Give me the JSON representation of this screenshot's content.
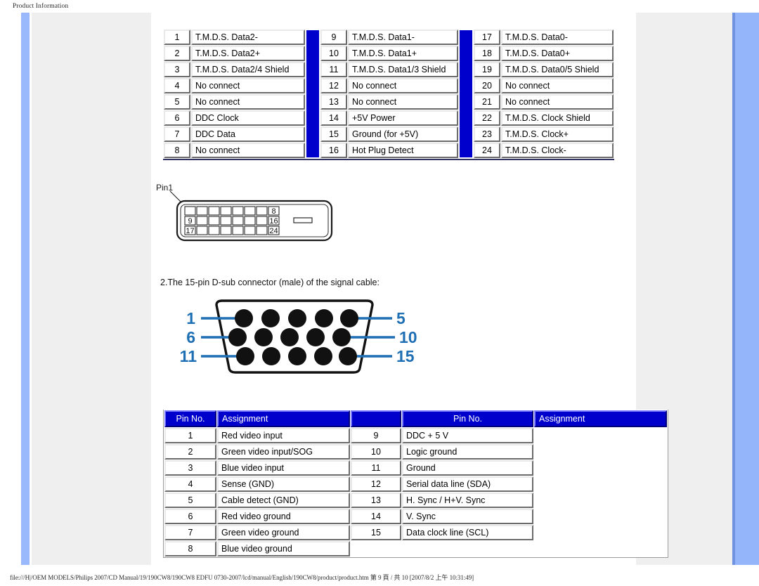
{
  "print_header": "Product Information",
  "print_footer": "file:///H|/OEM MODELS/Philips 2007/CD Manual/19/190CW8/190CW8 EDFU 0730-2007/lcd/manual/English/190CW8/product/product.htm 第 9 頁 / 共 10 [2007/8/2 上午 10:31:49]",
  "colors": {
    "table_header_blue": "#0000CC",
    "separator_blue": "#0000CC",
    "accent_bar_blue": "#95B5FB",
    "label_blue": "#1F6FB4",
    "page_background": "#EFEFF0"
  },
  "dvi_table": {
    "columns": [
      {
        "rows": [
          {
            "pin": "1",
            "assignment": "T.M.D.S. Data2-"
          },
          {
            "pin": "2",
            "assignment": "T.M.D.S. Data2+"
          },
          {
            "pin": "3",
            "assignment": "T.M.D.S. Data2/4 Shield"
          },
          {
            "pin": "4",
            "assignment": "No connect"
          },
          {
            "pin": "5",
            "assignment": "No connect"
          },
          {
            "pin": "6",
            "assignment": "DDC Clock"
          },
          {
            "pin": "7",
            "assignment": "DDC Data"
          },
          {
            "pin": "8",
            "assignment": "No connect"
          }
        ]
      },
      {
        "rows": [
          {
            "pin": "9",
            "assignment": "T.M.D.S. Data1-"
          },
          {
            "pin": "10",
            "assignment": "T.M.D.S. Data1+"
          },
          {
            "pin": "11",
            "assignment": "T.M.D.S. Data1/3 Shield"
          },
          {
            "pin": "12",
            "assignment": "No connect"
          },
          {
            "pin": "13",
            "assignment": "No connect"
          },
          {
            "pin": "14",
            "assignment": "+5V Power"
          },
          {
            "pin": "15",
            "assignment": "Ground (for +5V)"
          },
          {
            "pin": "16",
            "assignment": "Hot Plug Detect"
          }
        ]
      },
      {
        "rows": [
          {
            "pin": "17",
            "assignment": "T.M.D.S. Data0-"
          },
          {
            "pin": "18",
            "assignment": "T.M.D.S. Data0+"
          },
          {
            "pin": "19",
            "assignment": "T.M.D.S. Data0/5 Shield"
          },
          {
            "pin": "20",
            "assignment": "No connect"
          },
          {
            "pin": "21",
            "assignment": "No connect"
          },
          {
            "pin": "22",
            "assignment": "T.M.D.S. Clock Shield"
          },
          {
            "pin": "23",
            "assignment": "T.M.D.S. Clock+"
          },
          {
            "pin": "24",
            "assignment": "T.M.D.S. Clock-"
          }
        ]
      }
    ]
  },
  "dvi_connector": {
    "pin1_label": "Pin1",
    "corner_labels": [
      "8",
      "9",
      "16",
      "17",
      "24"
    ]
  },
  "caption": "2.The 15-pin D-sub connector (male) of the signal cable:",
  "dsub_connector": {
    "left_labels": [
      "1",
      "6",
      "11"
    ],
    "right_labels": [
      "5",
      "10",
      "15"
    ],
    "rows": [
      5,
      5,
      5
    ]
  },
  "dsub_table": {
    "header": {
      "pin_no": "Pin No.",
      "assignment": "Assignment"
    },
    "left_rows": [
      {
        "pin": "1",
        "assignment": "Red video input"
      },
      {
        "pin": "2",
        "assignment": "Green video input/SOG"
      },
      {
        "pin": "3",
        "assignment": "Blue video input"
      },
      {
        "pin": "4",
        "assignment": "Sense (GND)"
      },
      {
        "pin": "5",
        "assignment": "Cable detect (GND)"
      },
      {
        "pin": "6",
        "assignment": "Red video ground"
      },
      {
        "pin": "7",
        "assignment": "Green video ground"
      },
      {
        "pin": "8",
        "assignment": "Blue video ground"
      }
    ],
    "right_rows": [
      {
        "pin": "9",
        "assignment": "DDC + 5 V"
      },
      {
        "pin": "10",
        "assignment": "Logic ground"
      },
      {
        "pin": "11",
        "assignment": "Ground"
      },
      {
        "pin": "12",
        "assignment": "Serial data line (SDA)"
      },
      {
        "pin": "13",
        "assignment": "H. Sync / H+V. Sync"
      },
      {
        "pin": "14",
        "assignment": "V. Sync"
      },
      {
        "pin": "15",
        "assignment": "Data clock line (SCL)"
      },
      {
        "pin": "",
        "assignment": ""
      }
    ]
  }
}
